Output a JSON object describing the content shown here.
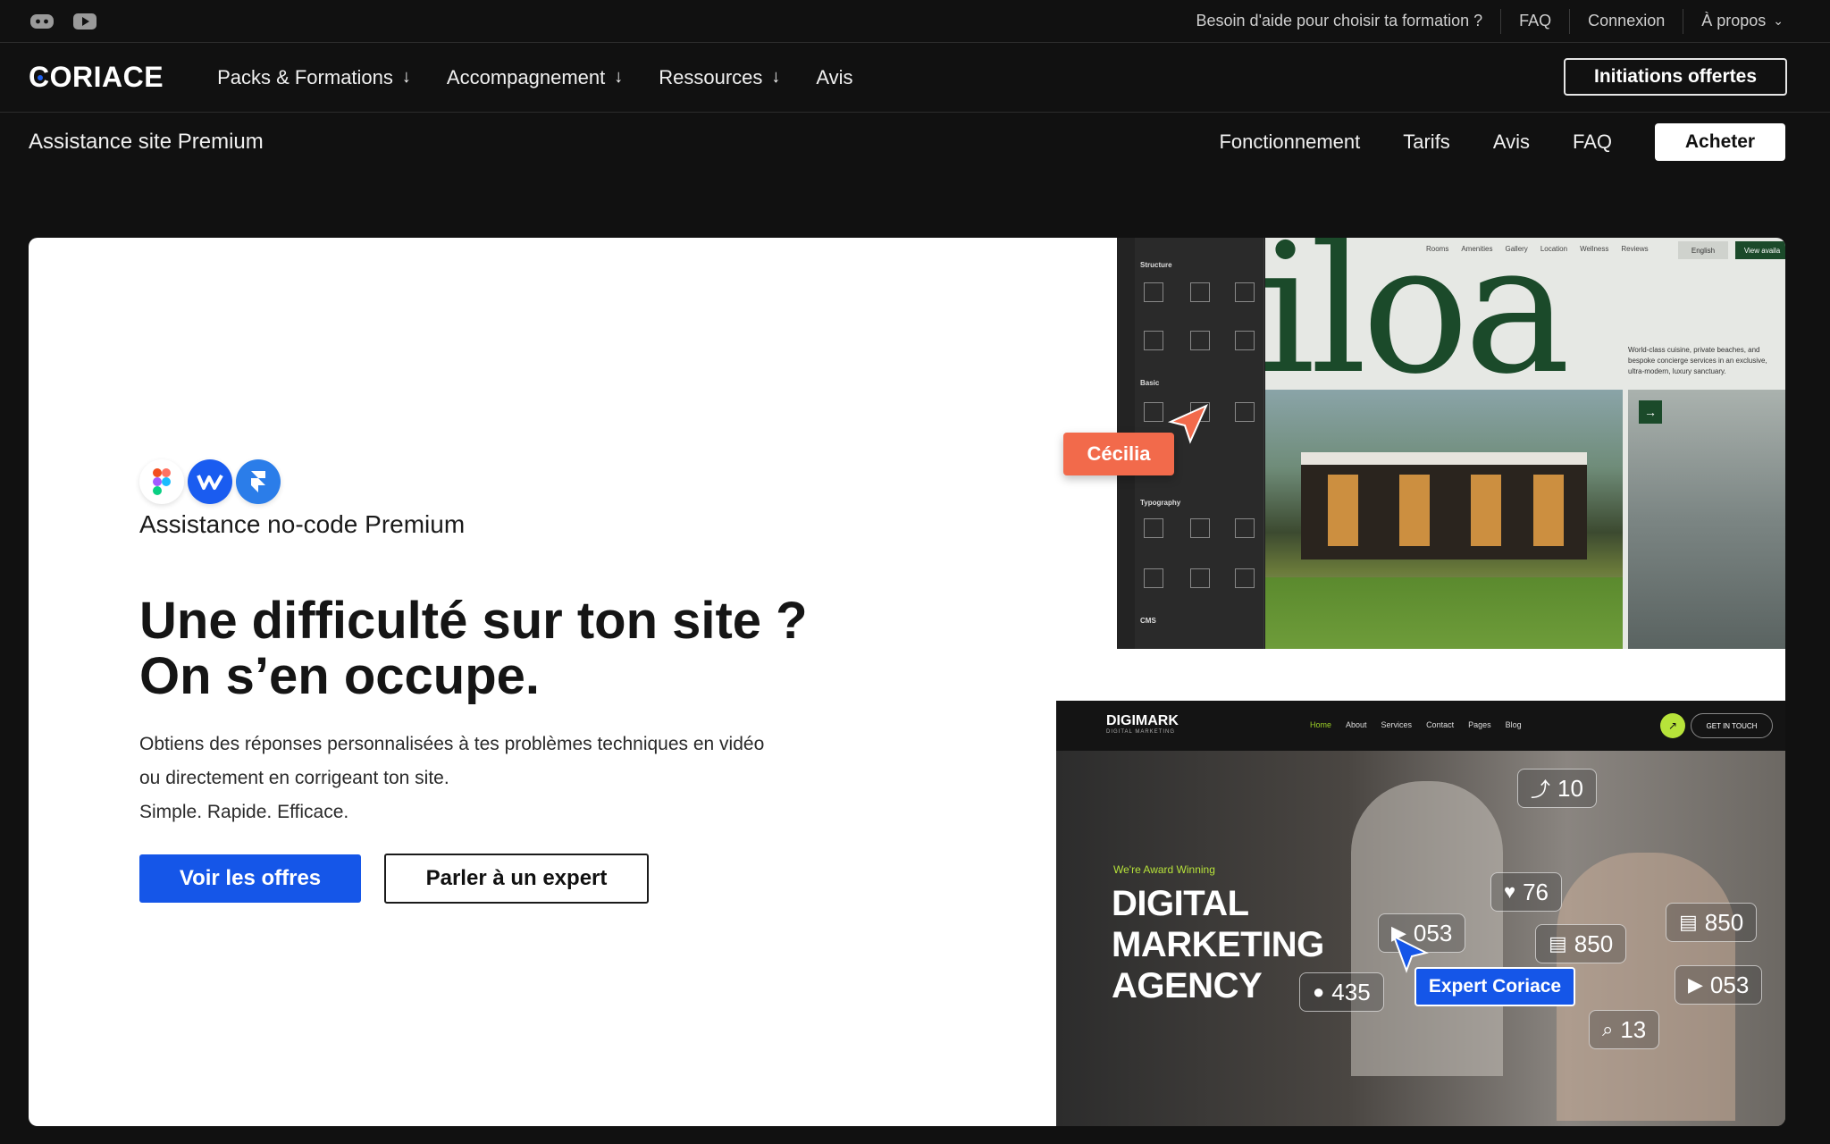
{
  "topbar": {
    "social": [
      {
        "icon": "discord-icon"
      },
      {
        "icon": "youtube-icon"
      }
    ],
    "links": [
      "Besoin d'aide pour choisir ta formation ?",
      "FAQ",
      "Connexion",
      "À propos"
    ]
  },
  "mainnav": {
    "logo": "CORIACE",
    "items": [
      {
        "label": "Packs & Formations",
        "dropdown": true
      },
      {
        "label": "Accompagnement",
        "dropdown": true
      },
      {
        "label": "Ressources",
        "dropdown": true
      },
      {
        "label": "Avis",
        "dropdown": false
      }
    ],
    "cta": "Initiations offertes"
  },
  "subnav": {
    "title": "Assistance site Premium",
    "links": [
      "Fonctionnement",
      "Tarifs",
      "Avis",
      "FAQ"
    ],
    "buy": "Acheter"
  },
  "hero": {
    "tool_icons": [
      "figma-icon",
      "webflow-icon",
      "framer-icon"
    ],
    "eyebrow": "Assistance no-code Premium",
    "headline_line1": "Une difficulté sur ton site ?",
    "headline_line2": "On s’en occupe.",
    "desc_line1": "Obtiens des réponses personnalisées à tes problèmes techniques en vidéo",
    "desc_line2": "ou directement en corrigeant ton site.",
    "desc_line3": "Simple. Rapide. Efficace.",
    "primary_btn": "Voir les offres",
    "secondary_btn": "Parler à un expert"
  },
  "editor": {
    "sections": [
      "Structure",
      "Basic",
      "Typography",
      "CMS"
    ],
    "site_word": "iloa",
    "menu": [
      "Rooms",
      "Amenities",
      "Gallery",
      "Location",
      "Wellness",
      "Reviews"
    ],
    "lang": "English",
    "cta": "View availa",
    "blurb": "World-class cuisine, private beaches, and bespoke concierge services in an exclusive, ultra-modern, luxury sanctuary."
  },
  "cursor_tag": "Cécilia",
  "marketing": {
    "brand": "DIGIMARK",
    "brand_sub": "DIGITAL MARKETING",
    "menu": [
      "Home",
      "About",
      "Services",
      "Contact",
      "Pages",
      "Blog"
    ],
    "get_in_touch": "GET IN TOUCH",
    "award": "We're Award Winning",
    "headline_1": "DIGITAL",
    "headline_2": "MARKETING",
    "headline_3": "AGENCY",
    "bubbles": [
      "10",
      "76",
      "053",
      "850",
      "435",
      "13",
      "850",
      "053"
    ]
  },
  "expert_tag": "Expert Coriace",
  "colors": {
    "primary": "#1556e8",
    "accent_orange": "#f26a4b",
    "background": "#111111",
    "card": "#ffffff"
  }
}
